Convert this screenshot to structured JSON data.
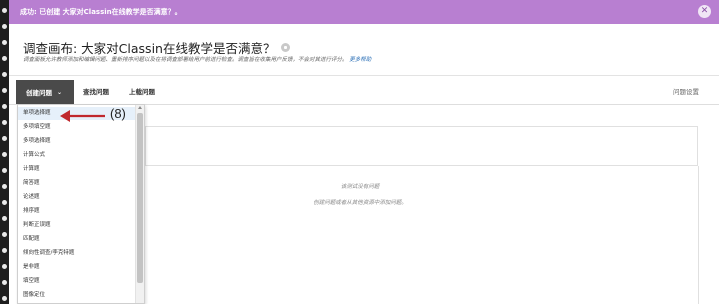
{
  "banner": {
    "message": "成功: 已创建 大家对Classin在线教学是否满意？。",
    "close_icon": "close-icon"
  },
  "header": {
    "title": "调查画布: 大家对Classin在线教学是否满意？",
    "description": "调查面板允许教师添加和编辑问题、重新排序问题以及在将调查部署给用户前进行检查。调查旨在收集用户反馈，不会对其进行评分。",
    "more_link": "更多帮助"
  },
  "toolbar": {
    "create_label": "创建问题",
    "find_label": "查找问题",
    "upload_label": "上载问题",
    "settings_label": "问题设置"
  },
  "empty_state": {
    "title": "该测试没有问题",
    "hint": "创建问题或者从其他资源中添加问题。"
  },
  "dropdown": {
    "items": [
      "单项选择题",
      "多项填空题",
      "多项选择题",
      "计算公式",
      "计算题",
      "简答题",
      "论述题",
      "排序题",
      "判断正误题",
      "匹配题",
      "倾向性调查/李克特题",
      "是非题",
      "填空题",
      "图像定位"
    ],
    "selected": "单项选择题"
  },
  "annotation": {
    "label": "(8)"
  },
  "colors": {
    "banner": "#b87fd1",
    "toolbar_active": "#4a4a4a",
    "arrow": "#c0282d",
    "link": "#2b6fb6"
  }
}
